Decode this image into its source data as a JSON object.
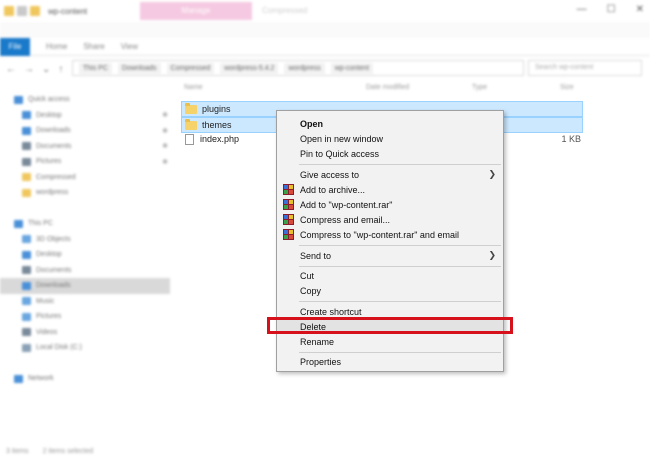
{
  "window": {
    "tab_manage": "Manage",
    "tab_compressed": "Compressed",
    "title": "wp-content",
    "controls": [
      "—",
      "☐",
      "✕"
    ]
  },
  "ribbon": {
    "file": "File",
    "tabs": [
      "Home",
      "Share",
      "View"
    ]
  },
  "address": {
    "breadcrumbs": [
      "This PC",
      "Downloads",
      "Compressed",
      "wordpress-5.4.2",
      "wordpress",
      "wp-content"
    ],
    "search_placeholder": "Search wp-content"
  },
  "sidebar": {
    "items": [
      {
        "label": "Quick access",
        "color": "#4a90d9"
      },
      {
        "label": "Desktop",
        "color": "#4a90d9"
      },
      {
        "label": "Downloads",
        "color": "#4a90d9"
      },
      {
        "label": "Documents",
        "color": "#7a8a9a"
      },
      {
        "label": "Pictures",
        "color": "#7a8a9a"
      },
      {
        "label": "Compressed",
        "color": "#f0c75e"
      },
      {
        "label": "wordpress",
        "color": "#f0c75e"
      },
      {
        "label": "",
        "color": "#ffffff"
      },
      {
        "label": "This PC",
        "color": "#4a90d9"
      },
      {
        "label": "3D Objects",
        "color": "#6aa6e0"
      },
      {
        "label": "Desktop",
        "color": "#4a90d9"
      },
      {
        "label": "Documents",
        "color": "#7a8a9a"
      },
      {
        "label": "Downloads",
        "color": "#4a90d9"
      },
      {
        "label": "Music",
        "color": "#6aa6e0"
      },
      {
        "label": "Pictures",
        "color": "#6aa6e0"
      },
      {
        "label": "Videos",
        "color": "#7a8a9a"
      },
      {
        "label": "Local Disk (C:)",
        "color": "#8aa0b5"
      },
      {
        "label": "",
        "color": "#ffffff"
      },
      {
        "label": "Network",
        "color": "#4a90d9"
      }
    ]
  },
  "columns": {
    "name": "Name",
    "date": "Date modified",
    "type": "Type",
    "size": "Size"
  },
  "files": [
    {
      "name": "plugins",
      "kind": "folder",
      "size": "",
      "selected": true
    },
    {
      "name": "themes",
      "kind": "folder",
      "size": "",
      "selected": true
    },
    {
      "name": "index.php",
      "kind": "file",
      "size": "1 KB",
      "selected": false
    }
  ],
  "status": {
    "count": "3 items",
    "selected": "2 items selected"
  },
  "context_menu": {
    "open": "Open",
    "open_new_window": "Open in new window",
    "pin_quick_access": "Pin to Quick access",
    "give_access": "Give access to",
    "add_archive": "Add to archive...",
    "add_rar": "Add to \"wp-content.rar\"",
    "compress_email": "Compress and email...",
    "compress_rar_email": "Compress to \"wp-content.rar\" and email",
    "send_to": "Send to",
    "cut": "Cut",
    "copy": "Copy",
    "create_shortcut": "Create shortcut",
    "delete": "Delete",
    "rename": "Rename",
    "properties": "Properties",
    "submenu_arrow": "❯"
  },
  "colors": {
    "highlight": "#d6111b",
    "selection": "#cce8ff",
    "file_tab": "#1979ca",
    "manage_tab": "#f5c9e1"
  }
}
